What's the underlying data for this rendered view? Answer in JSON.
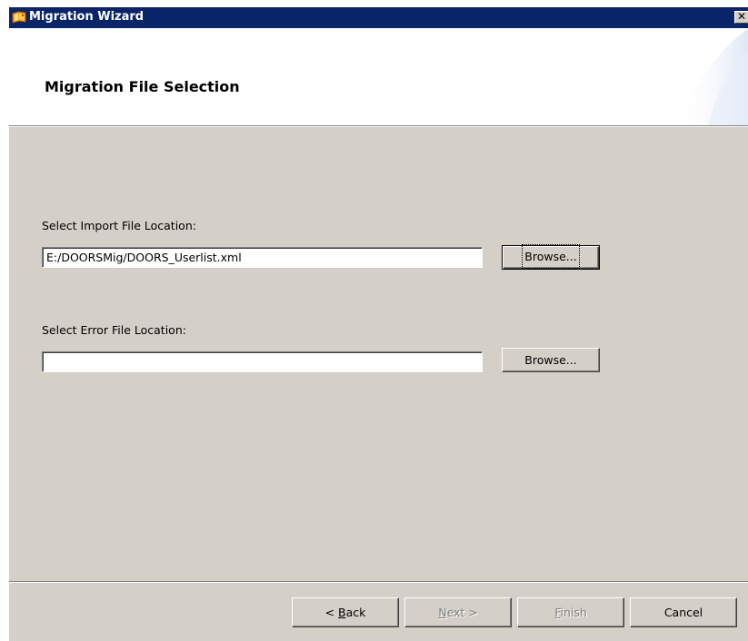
{
  "window": {
    "title": "Migration Wizard",
    "close_glyph": "✕",
    "app_icon": "wizard-app-icon"
  },
  "header": {
    "title": "Migration File Selection"
  },
  "import": {
    "label": "Select Import File Location:",
    "value": "E:/DOORSMig/DOORS_Userlist.xml",
    "placeholder": "",
    "browse_label": "Browse..."
  },
  "error": {
    "label": "Select Error File Location:",
    "value": "",
    "placeholder": "",
    "browse_label": "Browse..."
  },
  "footer": {
    "back_prefix": "< ",
    "back_mnemonic": "B",
    "back_rest": "ack",
    "next_mnemonic": "N",
    "next_rest": "ext >",
    "finish_mnemonic": "F",
    "finish_rest": "inish",
    "cancel_label": "Cancel"
  },
  "colors": {
    "titlebar": "#0a246a",
    "dialog_face": "#d4d0c8",
    "header_bg": "#ffffff",
    "disabled_text": "#808080"
  }
}
